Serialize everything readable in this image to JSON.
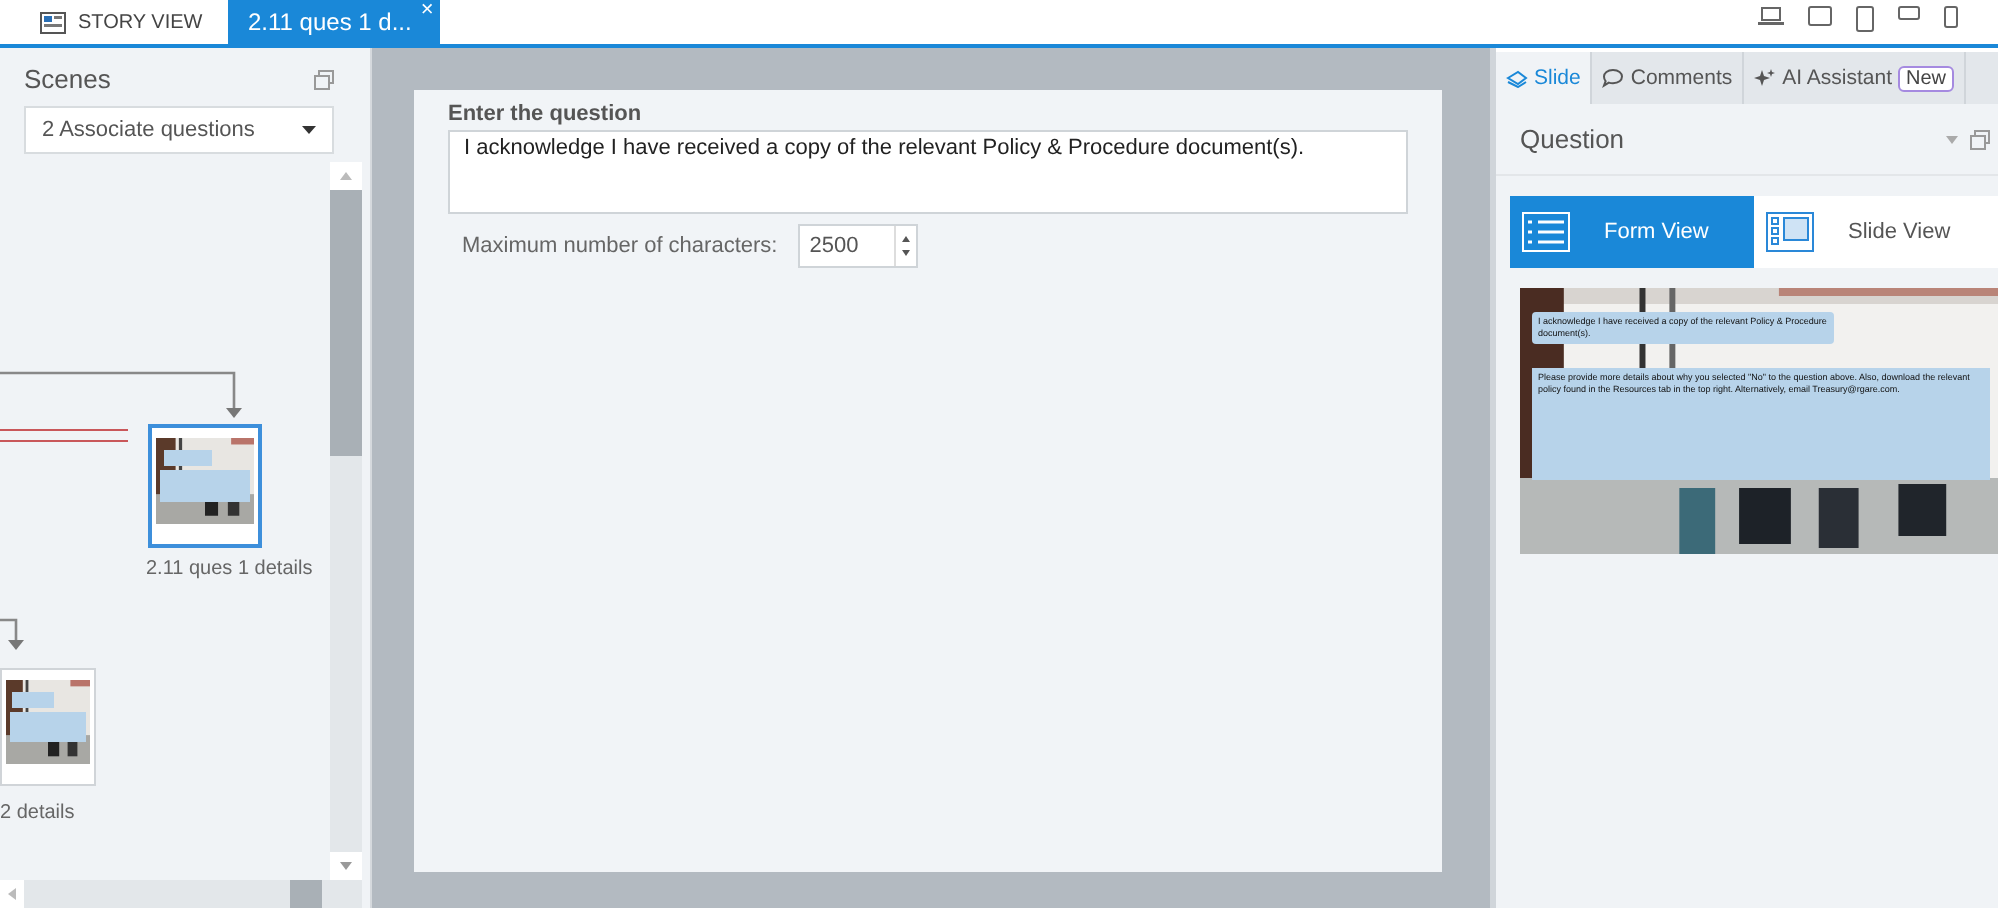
{
  "tabs": [
    {
      "label": "STORY VIEW",
      "selected": false
    },
    {
      "label": "2.11 ques 1 d...",
      "selected": true,
      "close": "×"
    }
  ],
  "scenes": {
    "title": "Scenes",
    "dropdown": "2 Associate questions",
    "nodes": [
      {
        "label": "2.11 ques 1 details",
        "selected": true
      },
      {
        "label": "2 details",
        "selected": false
      }
    ]
  },
  "form": {
    "question_label": "Enter the question",
    "question": "I acknowledge I have received a copy of the relevant Policy & Procedure document(s).",
    "max_label": "Maximum number of characters:",
    "max_value": "2500"
  },
  "panel": {
    "tabs": [
      {
        "label": "Slide",
        "selected": true
      },
      {
        "label": "Comments",
        "selected": false
      },
      {
        "label": "AI Assistant",
        "selected": false,
        "badge": "New"
      }
    ],
    "section": "Question",
    "views": [
      {
        "label": "Form View",
        "selected": true
      },
      {
        "label": "Slide View",
        "selected": false
      }
    ],
    "preview": {
      "question": "I acknowledge I have received a copy of the relevant Policy & Procedure document(s).",
      "feedback": "Please provide more details about why you selected \"No\" to the question above. Also, download the relevant policy found in the Resources tab in the top right. Alternatively, email Treasury@rgare.com."
    }
  }
}
